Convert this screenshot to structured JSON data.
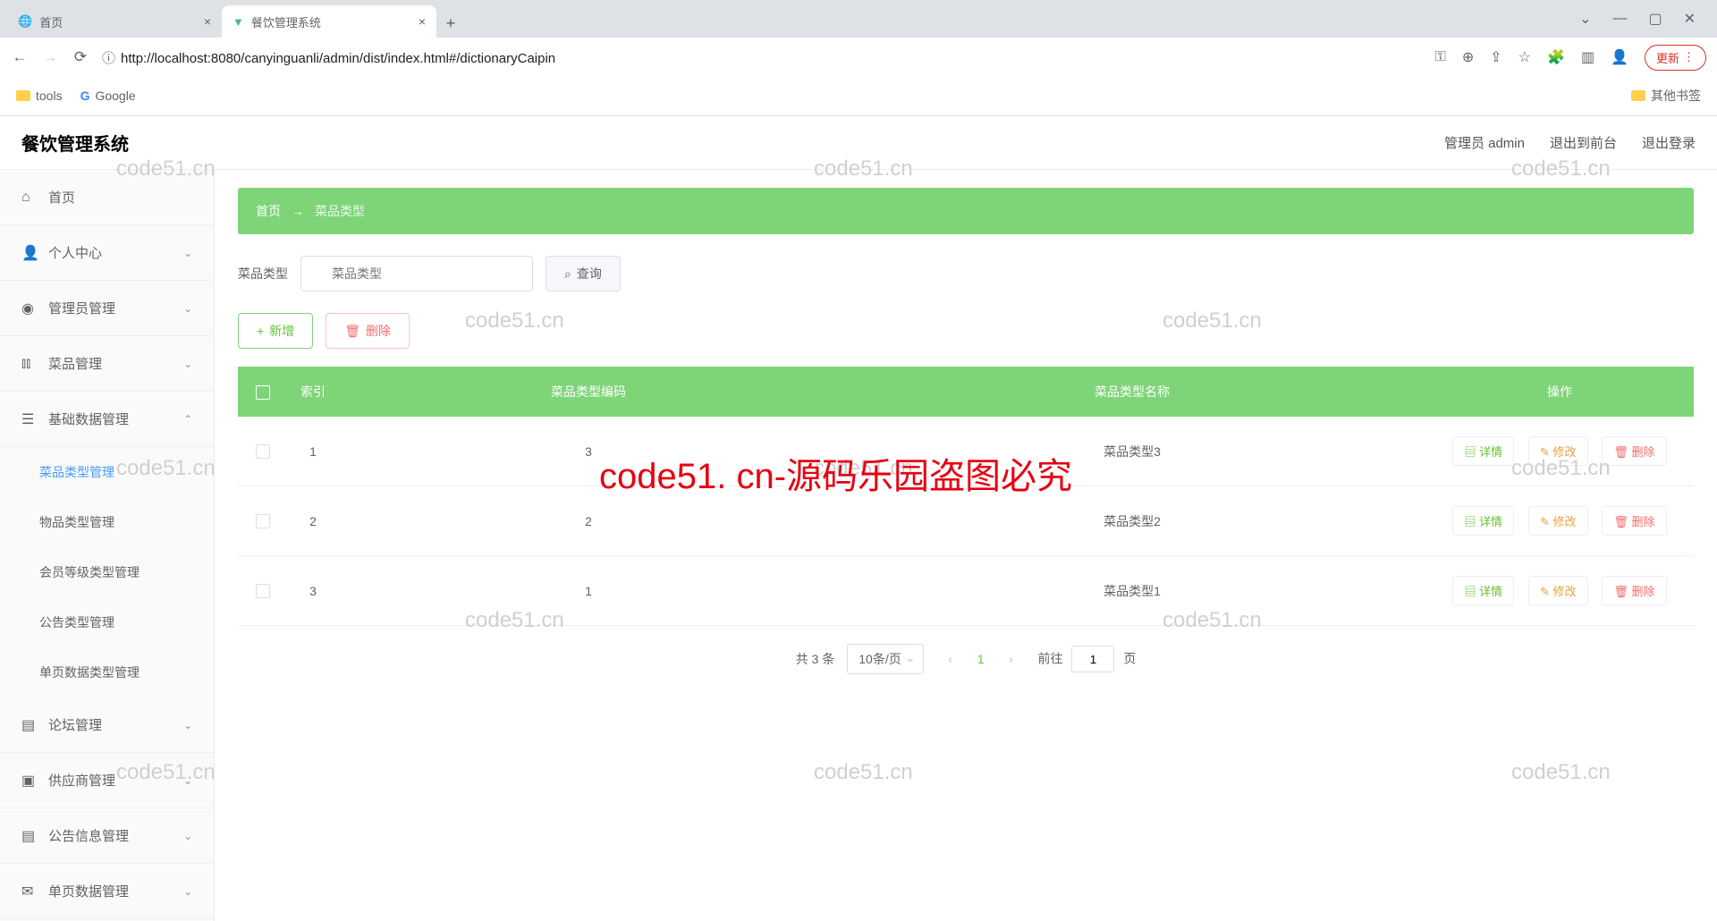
{
  "browser": {
    "tabs": [
      {
        "title": "首页",
        "active": false
      },
      {
        "title": "餐饮管理系统",
        "active": true
      }
    ],
    "url": "http://localhost:8080/canyinguanli/admin/dist/index.html#/dictionaryCaipin",
    "bookmarks": {
      "tools": "tools",
      "google": "Google",
      "other": "其他书签"
    },
    "update": "更新"
  },
  "header": {
    "appTitle": "餐饮管理系统",
    "adminLabel": "管理员 admin",
    "toFront": "退出到前台",
    "logout": "退出登录"
  },
  "sidebar": {
    "home": "首页",
    "personal": "个人中心",
    "adminMgmt": "管理员管理",
    "dishMgmt": "菜品管理",
    "baseData": "基础数据管理",
    "sub": {
      "dishType": "菜品类型管理",
      "itemType": "物品类型管理",
      "memberLevel": "会员等级类型管理",
      "noticeType": "公告类型管理",
      "singlePage": "单页数据类型管理"
    },
    "forum": "论坛管理",
    "supplier": "供应商管理",
    "noticeInfo": "公告信息管理",
    "singleData": "单页数据管理"
  },
  "breadcrumb": {
    "home": "首页",
    "current": "菜品类型"
  },
  "search": {
    "label": "菜品类型",
    "placeholder": "菜品类型",
    "queryBtn": "查询"
  },
  "actions": {
    "add": "新增",
    "delete": "删除"
  },
  "table": {
    "cols": {
      "index": "索引",
      "code": "菜品类型编码",
      "name": "菜品类型名称",
      "ops": "操作"
    },
    "rows": [
      {
        "idx": "1",
        "code": "3",
        "name": "菜品类型3"
      },
      {
        "idx": "2",
        "code": "2",
        "name": "菜品类型2"
      },
      {
        "idx": "3",
        "code": "1",
        "name": "菜品类型1"
      }
    ],
    "rowBtns": {
      "detail": "详情",
      "edit": "修改",
      "delete": "删除"
    }
  },
  "pagination": {
    "total": "共 3 条",
    "pageSize": "10条/页",
    "current": "1",
    "gotoPrefix": "前往",
    "gotoVal": "1",
    "gotoSuffix": "页"
  },
  "watermark": "code51.cn",
  "redText": "code51. cn-源码乐园盗图必究"
}
